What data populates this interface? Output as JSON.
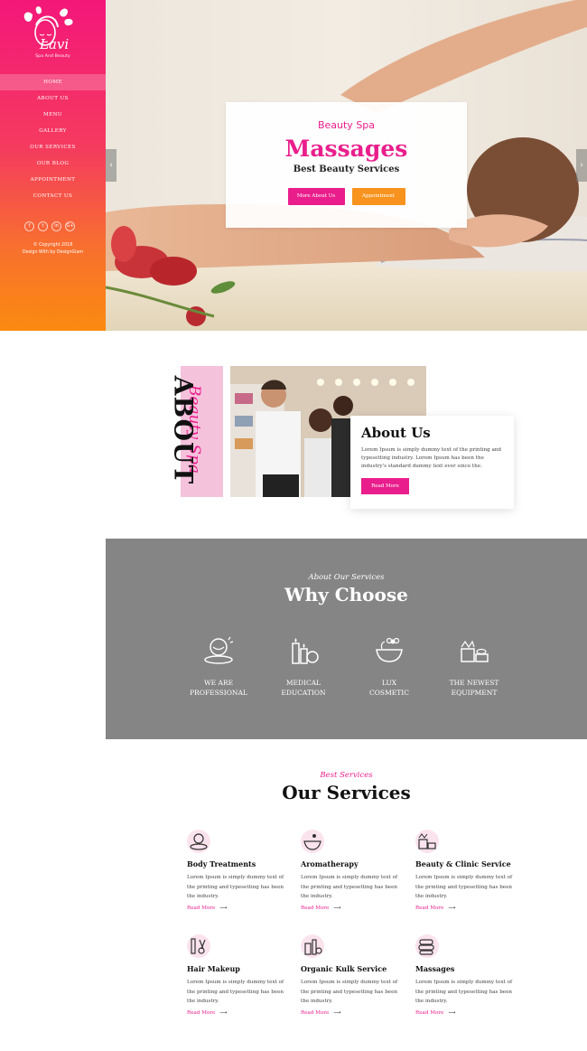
{
  "sidebar": {
    "brand": "Lavi",
    "tagline": "Spa And Beauty",
    "nav": [
      {
        "label": "HOME",
        "active": true
      },
      {
        "label": "ABOUT US"
      },
      {
        "label": "MENU"
      },
      {
        "label": "GALLERY"
      },
      {
        "label": "OUR SERVICES"
      },
      {
        "label": "OUR BLOG"
      },
      {
        "label": "APPOINTMENT"
      },
      {
        "label": "CONTACT US"
      }
    ],
    "socials": [
      "f",
      "t",
      "in",
      "G+"
    ],
    "copyright_line1": "© Copyright 2018",
    "copyright_line2": "Design With by DesignGlam"
  },
  "hero": {
    "kicker": "Beauty Spa",
    "title": "Massages",
    "subtitle": "Best Beauty Services",
    "btn_about": "More About Us",
    "btn_appointment": "Appointment",
    "prev_arrow": "‹",
    "next_arrow": "›"
  },
  "about": {
    "script": "Beauty Spa",
    "vertical_word": "ABOUT",
    "title": "About Us",
    "text": "Lorem Ipsum is simply dummy text of the printing and typesetting industry. Lorem Ipsum has been the industry's standard dummy text ever since the.",
    "btn": "Read More"
  },
  "why": {
    "script": "About Our Services",
    "title": "Why Choose",
    "features": [
      {
        "line1": "WE ARE",
        "line2": "PROFESSIONAL",
        "icon": "massage-icon"
      },
      {
        "line1": "MEDICAL",
        "line2": "EDUCATION",
        "icon": "candles-icon"
      },
      {
        "line1": "LUX",
        "line2": "COSMETIC",
        "icon": "mortar-flower-icon"
      },
      {
        "line1": "THE NEWEST",
        "line2": "EQUIPMENT",
        "icon": "spa-equipment-icon"
      }
    ]
  },
  "services": {
    "script": "Best Services",
    "title": "Our Services",
    "items": [
      {
        "title": "Body Treatments",
        "text": "Lorem Ipsum is simply dummy text of the printing and typesetting has been the industry.",
        "link": "Read More",
        "icon": "face-massage-icon"
      },
      {
        "title": "Aromatherapy",
        "text": "Lorem Ipsum is simply dummy text of the printing and typesetting has been the industry.",
        "link": "Read More",
        "icon": "aroma-bowl-icon"
      },
      {
        "title": "Beauty & Clinic Service",
        "text": "Lorem Ipsum is simply dummy text of the printing and typesetting has been the industry.",
        "link": "Read More",
        "icon": "spa-stones-icon"
      },
      {
        "title": "Hair Makeup",
        "text": "Lorem Ipsum is simply dummy text of the printing and typesetting has been the industry.",
        "link": "Read More",
        "icon": "comb-scissors-icon"
      },
      {
        "title": "Organic Kulk Service",
        "text": "Lorem Ipsum is simply dummy text of the printing and typesetting has been the industry.",
        "link": "Read More",
        "icon": "cosmetics-icon"
      },
      {
        "title": "Massages",
        "text": "Lorem Ipsum is simply dummy text of the printing and typesetting has been the industry.",
        "link": "Read More",
        "icon": "towels-icon"
      }
    ]
  },
  "colors": {
    "accent": "#e91e8c",
    "orange": "#f7931e",
    "gray": "#858585"
  }
}
